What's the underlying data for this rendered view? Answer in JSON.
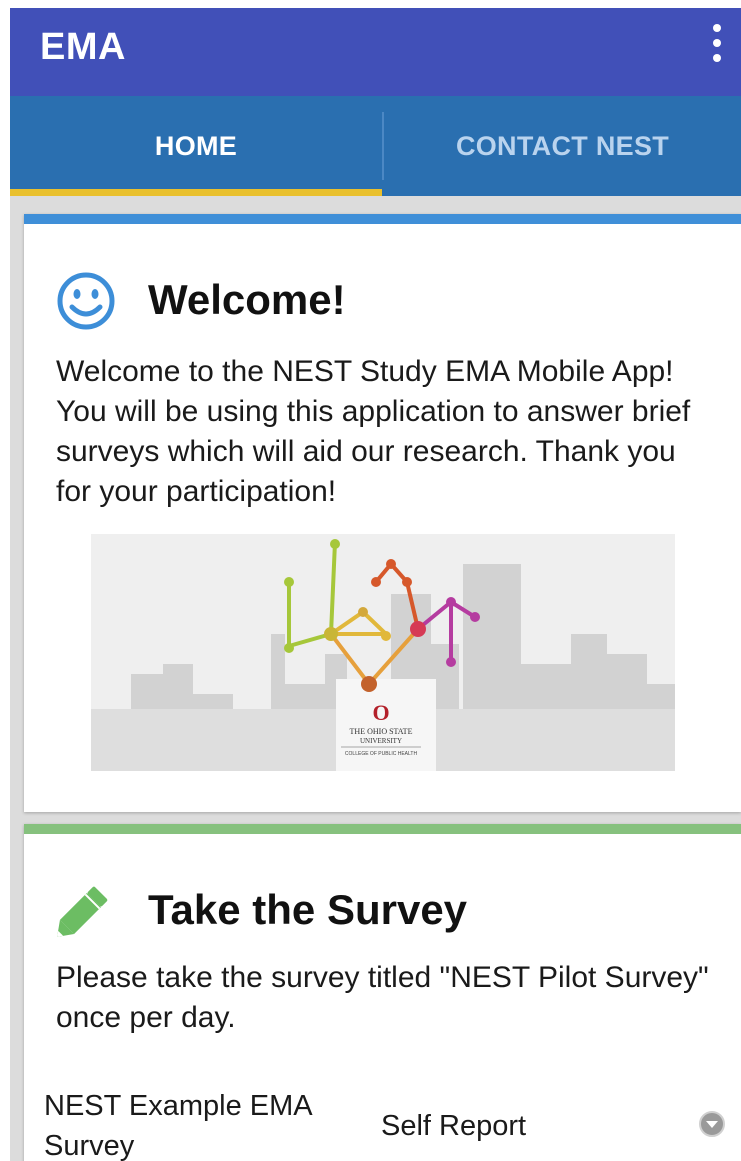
{
  "app_bar": {
    "title": "EMA",
    "menu_icon": "overflow-menu-icon"
  },
  "tabs": [
    {
      "label": "HOME",
      "selected": true
    },
    {
      "label": "CONTACT NEST",
      "selected": false
    }
  ],
  "welcome_card": {
    "icon": "smiley-icon",
    "heading": "Welcome!",
    "body": "Welcome to the NEST Study EMA Mobile App! You will be using this application to answer brief surveys which will aid our research.  Thank you for your participation!",
    "banner": {
      "university_line1": "THE OHIO STATE",
      "university_line2": "UNIVERSITY",
      "college": "COLLEGE OF PUBLIC HEALTH"
    }
  },
  "survey_card": {
    "icon": "pencil-icon",
    "heading": "Take the Survey",
    "body": "Please take the survey titled \"NEST Pilot Survey\" once per day.",
    "survey_item": {
      "name": "NEST Example EMA Survey",
      "type": "Self Report"
    }
  },
  "colors": {
    "app_bar": "#4150b8",
    "tab_bar": "#2a6fb0",
    "tab_indicator": "#e9c02d",
    "welcome_accent": "#3f8fd8",
    "survey_accent": "#86c17e"
  }
}
